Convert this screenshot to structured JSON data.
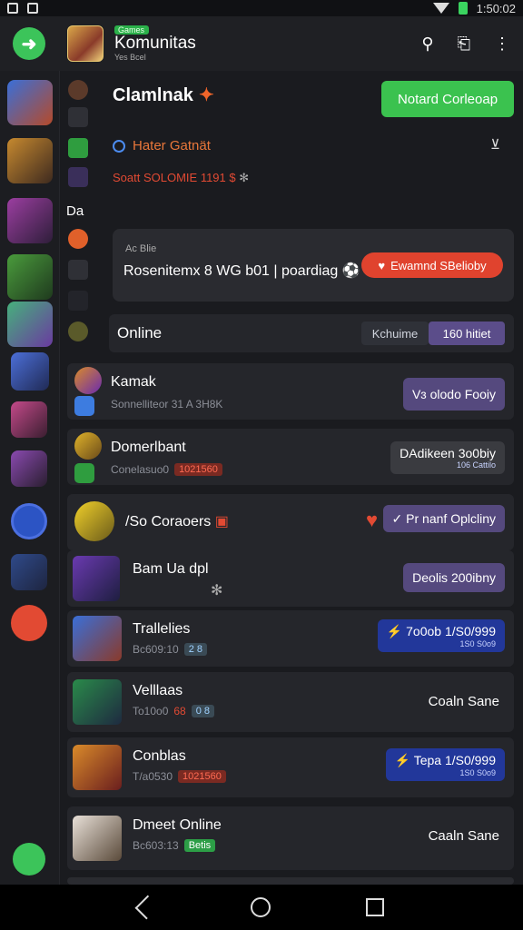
{
  "status": {
    "time": "1:50:02"
  },
  "appbar": {
    "badge": "Games",
    "title": "Komunitas",
    "subtitle": "Yes Bcel"
  },
  "header": {
    "title": "Clamlnak",
    "primary_button": "Notard Corleoap"
  },
  "info": {
    "line": "Hater Gatnät",
    "stat": "Soatt SOLOMIE 1191 $"
  },
  "side_label": "Da",
  "promo": {
    "small": "Ac Blie",
    "text": "Rosenitemx 8 WG b01 | poardiag",
    "button": "Ewamnd SBelioby"
  },
  "online": {
    "label": "Online",
    "seg1": "Kchuime",
    "seg2": "160 hitiet"
  },
  "rows": [
    {
      "title": "Kamak",
      "sub": "Sonnelliteor 31 A 3H8K",
      "button": "Vɜ olodo Fooiy",
      "tag": ""
    },
    {
      "title": "Domerlbant",
      "sub": "Conelasuo0",
      "tag": "1021560",
      "button": "DAdikeen 3o0biy",
      "button_small": "106 Cattilo"
    },
    {
      "title": "/So Coraoers",
      "button": "Pr nanf Oplcliny"
    },
    {
      "title": "Bam Ua dpl",
      "button": "Deolis 200ibny"
    },
    {
      "title": "Trallelies",
      "sub": "Bc609:10",
      "tag": "2 8",
      "button": "7o0ob 1/S0/999",
      "button_small": "1S0 S0o9"
    },
    {
      "title": "Velllaas",
      "sub": "To10o0",
      "tag": "68",
      "tag2": "0 8",
      "link": "Coaln Sane"
    },
    {
      "title": "Conblas",
      "sub": "T/a0530",
      "tag": "1021560",
      "button": "Tepa 1/S0/999",
      "button_small": "1S0 S0o9"
    },
    {
      "title": "Dmeet Online",
      "sub": "Bc603:13",
      "tag": "Betis",
      "link": "Caaln Sane"
    }
  ],
  "colors": {
    "accent_green": "#3bc24f",
    "accent_red": "#e24a33",
    "accent_purple": "#55497e"
  }
}
